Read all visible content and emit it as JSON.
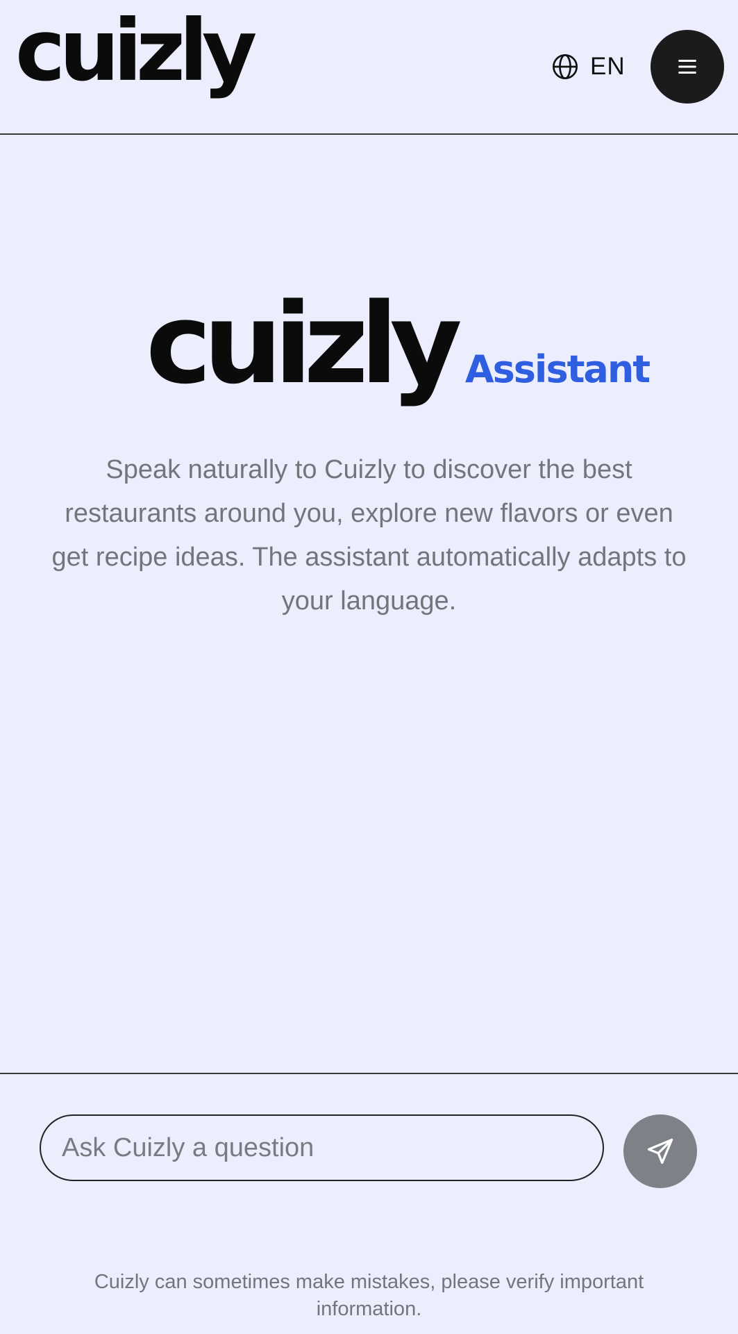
{
  "header": {
    "logo_text": "cuizly",
    "language_label": "EN",
    "language_icon": "globe-icon",
    "menu_icon": "hamburger-menu-icon"
  },
  "hero": {
    "logo_text": "cuizly",
    "assistant_label": "Assistant",
    "description": "Speak naturally to Cuizly to discover the best restaurants around you, explore new flavors or even get recipe ideas. The assistant automatically adapts to your language."
  },
  "composer": {
    "placeholder": "Ask Cuizly a question",
    "value": "",
    "send_icon": "send-icon"
  },
  "footer": {
    "disclaimer": "Cuizly can sometimes make mistakes, please verify important information."
  },
  "colors": {
    "background": "#eceefe",
    "accent": "#2f5fe0",
    "menu_button": "#1b1b1b",
    "send_button": "#7f8188",
    "muted_text": "#74757c"
  }
}
